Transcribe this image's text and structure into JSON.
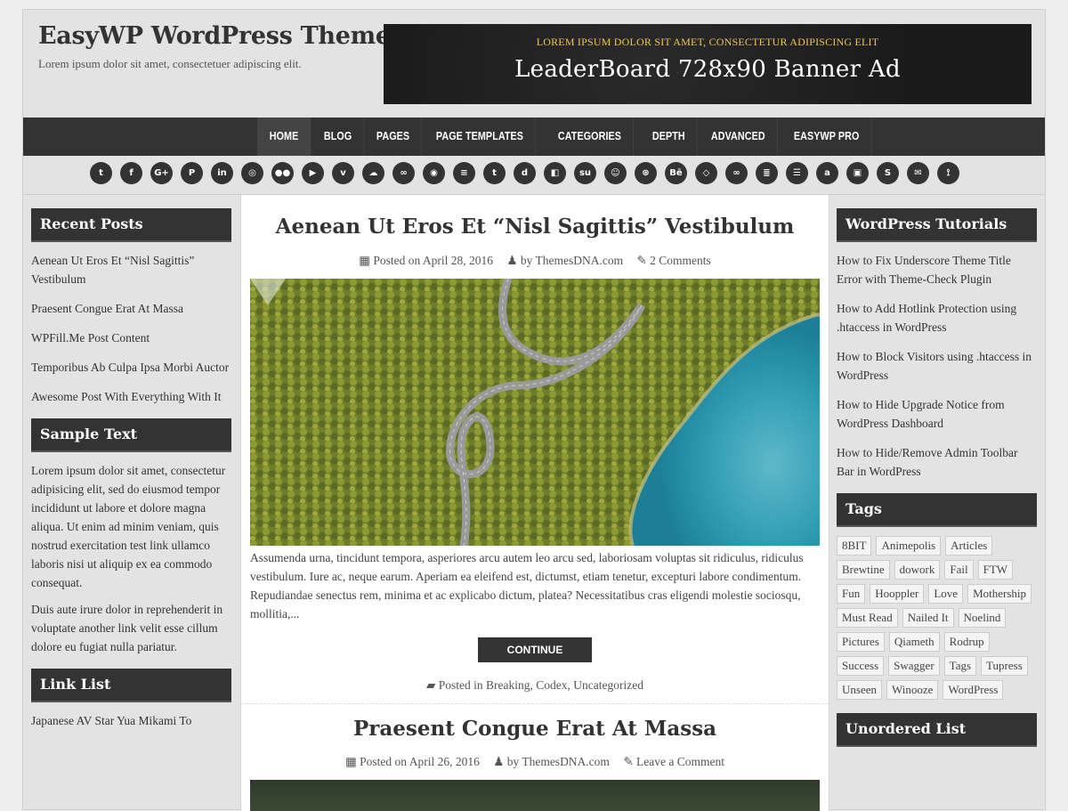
{
  "site": {
    "title": "EasyWP WordPress Theme",
    "description": "Lorem ipsum dolor sit amet, consectetuer adipiscing elit."
  },
  "banner": {
    "top_text": "LOREM IPSUM DOLOR SIT AMET, CONSECTETUR ADIPISCING ELIT",
    "main_text": "LeaderBoard 728x90 Banner Ad"
  },
  "nav": {
    "items": [
      "HOME",
      "BLOG",
      "PAGES",
      "PAGE TEMPLATES",
      "CATEGORIES",
      "DEPTH",
      "ADVANCED",
      "EASYWP PRO"
    ],
    "active": "HOME"
  },
  "social_icons": [
    "twitter",
    "facebook",
    "google-plus",
    "pinterest",
    "linkedin",
    "instagram",
    "flickr",
    "youtube",
    "vimeo",
    "soundcloud",
    "lastfm",
    "github",
    "stackoverflow",
    "tumblr",
    "digg",
    "delicious",
    "stumbleupon",
    "reddit",
    "dribbble",
    "behance",
    "codepen",
    "slideshare",
    "stack-exchange",
    "feed-list",
    "amazon",
    "github-alt",
    "skype",
    "email",
    "rss"
  ],
  "left_sidebar": {
    "recent_posts": {
      "title": "Recent Posts",
      "items": [
        "Aenean Ut Eros Et “Nisl Sagittis” Vestibulum",
        "Praesent Congue Erat At Massa",
        "WPFill.Me Post Content",
        "Temporibus Ab Culpa Ipsa Morbi Auctor",
        "Awesome Post With Everything With It"
      ]
    },
    "sample_text": {
      "title": "Sample Text",
      "p1": "Lorem ipsum dolor sit amet, consectetur adipisicing elit, sed do eiusmod tempor incididunt ut labore et dolore magna aliqua. Ut enim ad minim veniam, quis nostrud exercitation test link ullamco laboris nisi ut aliquip ex ea commodo consequat.",
      "p2": "Duis aute irure dolor in reprehenderit in voluptate another link velit esse cillum dolore eu fugiat nulla pariatur."
    },
    "link_list": {
      "title": "Link List",
      "items": [
        "Japanese AV Star Yua Mikami To"
      ]
    }
  },
  "right_sidebar": {
    "tutorials": {
      "title": "WordPress Tutorials",
      "items": [
        "How to Fix Underscore Theme Title Error with Theme-Check Plugin",
        "How to Add Hotlink Protection using .htaccess in WordPress",
        "How to Block Visitors using .htaccess in WordPress",
        "How to Hide Upgrade Notice from WordPress Dashboard",
        "How to Hide/Remove Admin Toolbar Bar in WordPress"
      ]
    },
    "tags": {
      "title": "Tags",
      "items": [
        "8BIT",
        "Animepolis",
        "Articles",
        "Brewtine",
        "dowork",
        "Fail",
        "FTW",
        "Fun",
        "Hooppler",
        "Love",
        "Mothership",
        "Must Read",
        "Nailed It",
        "Noelind",
        "Pictures",
        "Qiameth",
        "Rodrup",
        "Success",
        "Swagger",
        "Tags",
        "Tupress",
        "Unseen",
        "Winooze",
        "WordPress"
      ]
    },
    "unordered": {
      "title": "Unordered List"
    }
  },
  "posts": [
    {
      "title": "Aenean Ut Eros Et “Nisl Sagittis” Vestibulum",
      "posted_on_label": "Posted on",
      "date": "April 28, 2016",
      "by_label": "by",
      "author": "ThemesDNA.com",
      "comments": "2 Comments",
      "excerpt": "Assumenda urna, tincidunt tempora, asperiores arcu autem leo arcu sed, laboriosam voluptas sit ridiculus, ridiculus vestibulum. Iure ac, neque earum. Aperiam ea eleifend est, dictumst, etiam tenetur, excepturi labore condimentum. Repudiandae senectus rem, minima et ac explicabo dictum, platea? Necessitatibus cras eligendi molestie sociosqu, mollitia,...",
      "continue_label": "CONTINUE READING...",
      "posted_in_label": "Posted in",
      "categories": "Breaking, Codex, Uncategorized"
    },
    {
      "title": "Praesent Congue Erat At Massa",
      "posted_on_label": "Posted on",
      "date": "April 26, 2016",
      "by_label": "by",
      "author": "ThemesDNA.com",
      "comments": "Leave a Comment"
    }
  ],
  "colors": {
    "dark": "#333333",
    "background": "#e3e3e3",
    "banner_accent": "#f0c44c"
  }
}
